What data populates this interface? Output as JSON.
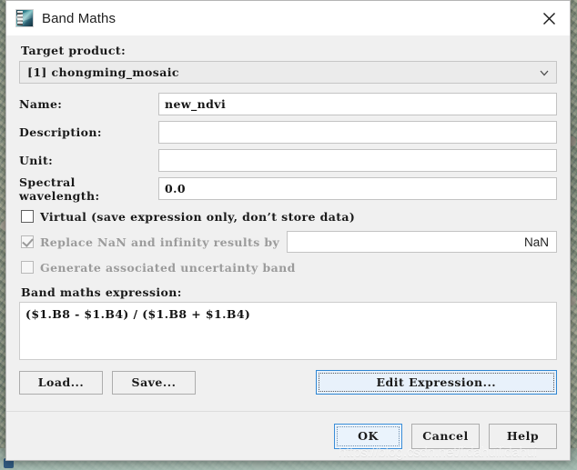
{
  "window": {
    "title": "Band Maths",
    "icon": "snap-app-icon",
    "close_label": "✕"
  },
  "form": {
    "target_product_label": "Target product:",
    "target_product_value": "[1] chongming_mosaic",
    "name_label": "Name:",
    "name_value": "new_ndvi",
    "description_label": "Description:",
    "description_value": "",
    "unit_label": "Unit:",
    "unit_value": "",
    "spectral_wavelength_label": "Spectral wavelength:",
    "spectral_wavelength_value": "0.0"
  },
  "options": {
    "virtual_label": "Virtual (save expression only, don’t store data)",
    "virtual_checked": false,
    "replace_nan_label": "Replace NaN and infinity results by",
    "replace_nan_checked": true,
    "replace_nan_value": "NaN",
    "uncertainty_label": "Generate associated uncertainty band",
    "uncertainty_checked": false
  },
  "expression": {
    "label": "Band maths expression:",
    "value": "($1.B8 - $1.B4) / ($1.B8 + $1.B4)"
  },
  "buttons": {
    "load": "Load...",
    "save": "Save...",
    "edit_expression": "Edit Expression...",
    "ok": "OK",
    "cancel": "Cancel",
    "help": "Help"
  },
  "watermark": {
    "text": "https://blog.csdn.net/lidahuilidahui"
  },
  "colors": {
    "dialog_bg": "#f0f0f0",
    "titlebar_bg": "#ffffff",
    "focus_blue": "#2f86d2",
    "focus_fill": "#e8f1fb",
    "field_bg": "#ffffff",
    "combo_bg": "#ebebeb",
    "disabled_text": "#9b9b9b"
  }
}
